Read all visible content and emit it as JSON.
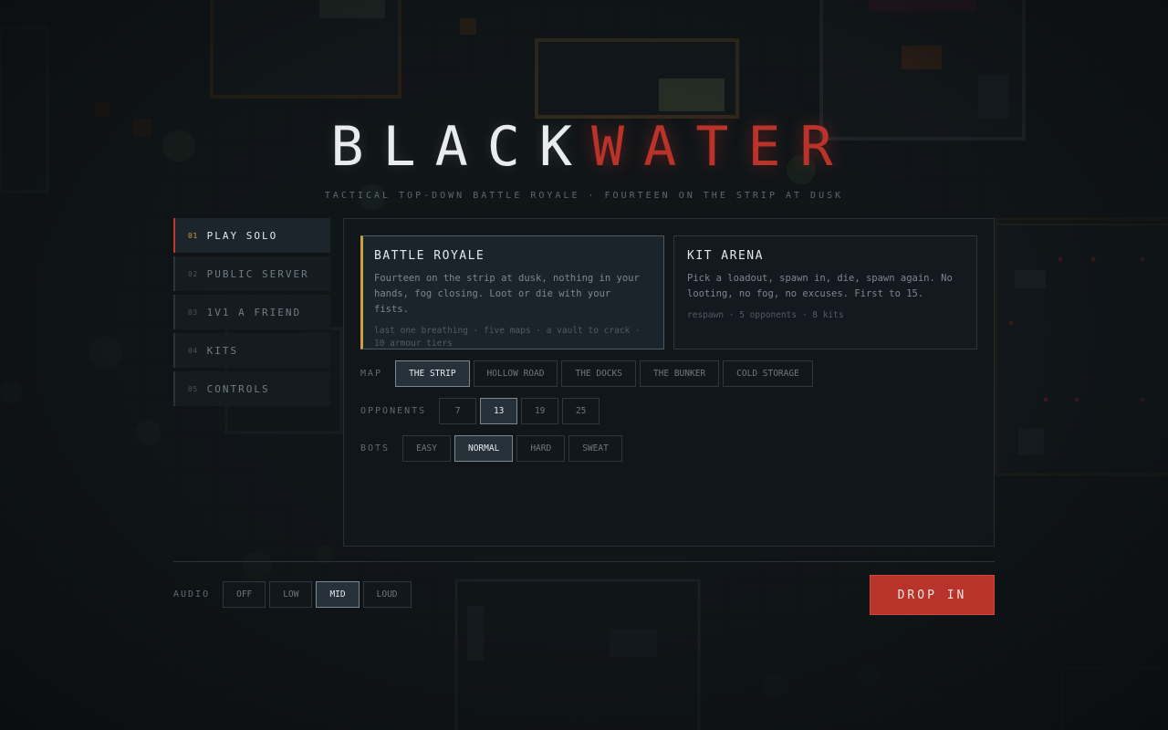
{
  "title": {
    "part1": "BLACK",
    "part2": "WATER"
  },
  "subtitle": "TACTICAL TOP-DOWN BATTLE ROYALE  ·  FOURTEEN ON THE STRIP AT DUSK",
  "nav": {
    "items": [
      {
        "num": "01",
        "label": "PLAY SOLO",
        "active": true
      },
      {
        "num": "02",
        "label": "PUBLIC SERVER",
        "active": false
      },
      {
        "num": "03",
        "label": "1V1 A FRIEND",
        "active": false
      },
      {
        "num": "04",
        "label": "KITS",
        "active": false
      },
      {
        "num": "05",
        "label": "CONTROLS",
        "active": false
      }
    ]
  },
  "modes": [
    {
      "title": "BATTLE ROYALE",
      "desc": "Fourteen on the strip at dusk, nothing in your hands, fog closing. Loot or die with your fists.",
      "meta": "last one breathing · five maps · a vault to crack · 10 armour tiers",
      "selected": true
    },
    {
      "title": "KIT ARENA",
      "desc": "Pick a loadout, spawn in, die, spawn again. No looting, no fog, no excuses. First to 15.",
      "meta": "respawn · 5 opponents · 8 kits",
      "selected": false
    }
  ],
  "options": {
    "map": {
      "label": "MAP",
      "values": [
        "THE STRIP",
        "HOLLOW ROAD",
        "THE DOCKS",
        "THE BUNKER",
        "COLD STORAGE"
      ],
      "selected": "THE STRIP"
    },
    "opponents": {
      "label": "OPPONENTS",
      "values": [
        "7",
        "13",
        "19",
        "25"
      ],
      "selected": "13"
    },
    "bots": {
      "label": "BOTS",
      "values": [
        "EASY",
        "NORMAL",
        "HARD",
        "SWEAT"
      ],
      "selected": "NORMAL"
    }
  },
  "audio": {
    "label": "AUDIO",
    "values": [
      "OFF",
      "LOW",
      "MID",
      "LOUD"
    ],
    "selected": "MID"
  },
  "drop_button": "DROP IN",
  "colors": {
    "accent_red": "#b8342a",
    "accent_gold": "#c9a23a",
    "background": "#0e1215",
    "panel": "#11161a"
  }
}
